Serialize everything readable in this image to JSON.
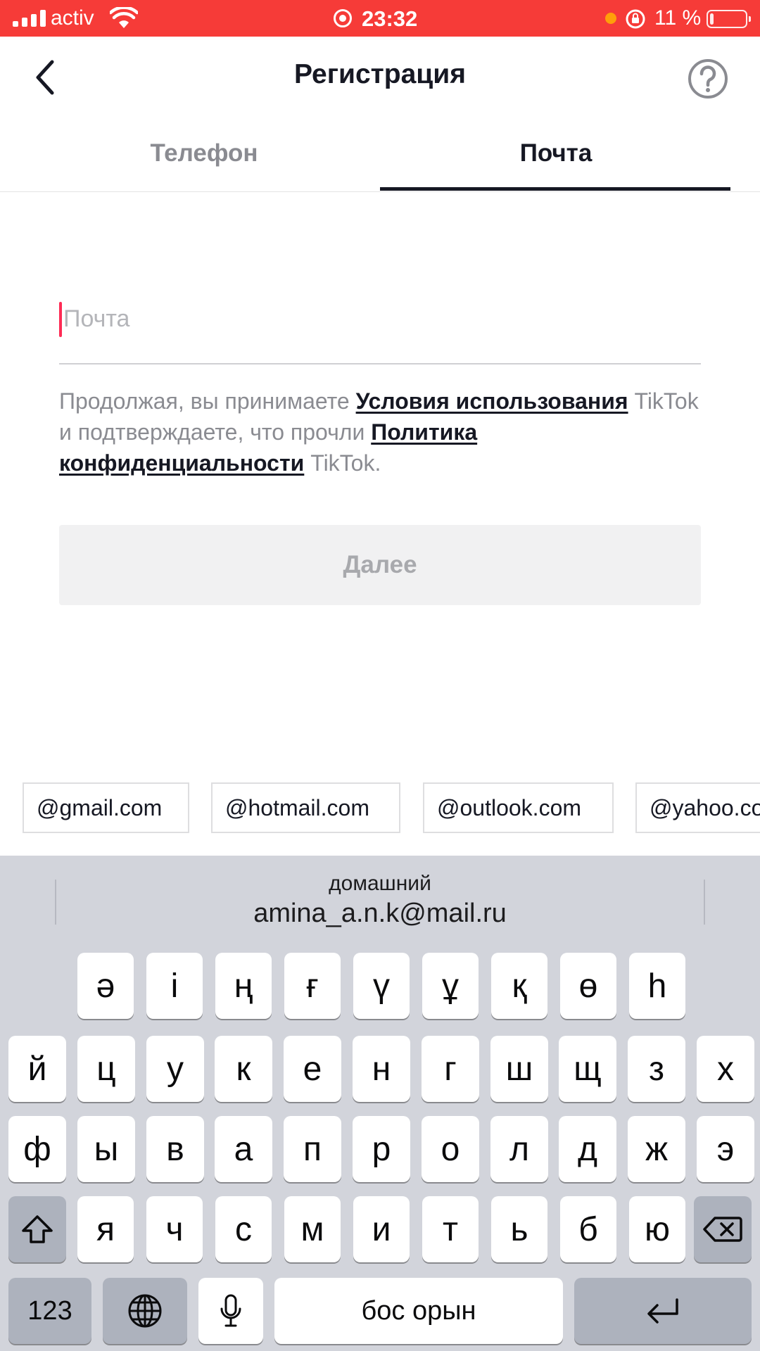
{
  "status_bar": {
    "carrier": "activ",
    "time": "23:32",
    "battery_percent_label": "11 %",
    "battery_level": 0.11
  },
  "header": {
    "title": "Регистрация",
    "back_icon": "chevron-left-icon",
    "help_icon": "question-circle-icon"
  },
  "tabs": [
    {
      "label": "Телефон",
      "active": false
    },
    {
      "label": "Почта",
      "active": true
    }
  ],
  "email_input": {
    "placeholder": "Почта",
    "value": ""
  },
  "terms": {
    "part1": "Продолжая, вы принимаете ",
    "link1": "Условия использования",
    "part2": " TikTok и подтверждаете, что прочли ",
    "link2": "Политика конфиденциальности",
    "part3": " TikTok."
  },
  "next_button": {
    "label": "Далее",
    "enabled": false
  },
  "domain_suggestions": [
    "@gmail.com",
    "@hotmail.com",
    "@outlook.com",
    "@yahoo.com"
  ],
  "keyboard": {
    "suggestion_label": "домашний",
    "suggestion_value": "amina_a.n.k@mail.ru",
    "row1": [
      "ә",
      "і",
      "ң",
      "ғ",
      "ү",
      "ұ",
      "қ",
      "ө",
      "һ"
    ],
    "row2": [
      "й",
      "ц",
      "у",
      "к",
      "е",
      "н",
      "г",
      "ш",
      "щ",
      "з",
      "х"
    ],
    "row3": [
      "ф",
      "ы",
      "в",
      "а",
      "п",
      "р",
      "о",
      "л",
      "д",
      "ж",
      "э"
    ],
    "row4": [
      "я",
      "ч",
      "с",
      "м",
      "и",
      "т",
      "ь",
      "б",
      "ю"
    ],
    "numbers_label": "123",
    "space_label": "бос орын",
    "icons": {
      "shift": "shift-icon",
      "backspace": "backspace-icon",
      "globe": "globe-icon",
      "mic": "microphone-icon",
      "return": "return-icon"
    }
  },
  "colors": {
    "status_bar": "#f63b38",
    "accent": "#fe2c55",
    "text_primary": "#161823",
    "text_secondary": "#8a8b91",
    "keyboard_bg": "#d2d4db"
  }
}
